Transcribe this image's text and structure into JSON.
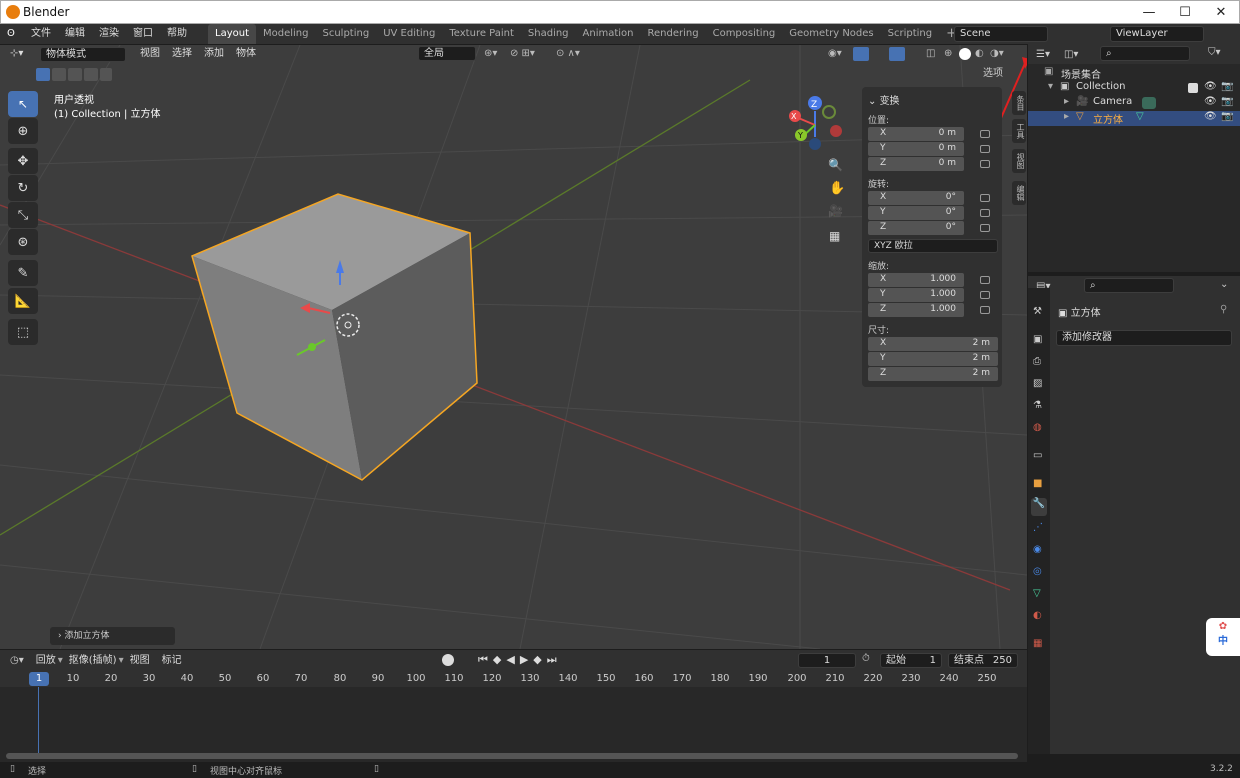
{
  "window": {
    "title": "Blender"
  },
  "menu": [
    "文件",
    "编辑",
    "渲染",
    "窗口",
    "帮助"
  ],
  "workspaces": [
    "Layout",
    "Modeling",
    "Sculpting",
    "UV Editing",
    "Texture Paint",
    "Shading",
    "Animation",
    "Rendering",
    "Compositing",
    "Geometry Nodes",
    "Scripting"
  ],
  "active_workspace": "Layout",
  "scene": "Scene",
  "view_layer": "ViewLayer",
  "viewport": {
    "mode": "物体模式",
    "menus": [
      "视图",
      "选择",
      "添加",
      "物体"
    ],
    "orientation": "全局",
    "options_label": "选项",
    "view_name": "用户透视",
    "collection_info": "(1) Collection | 立方体",
    "last_op": "添加立方体",
    "sidebar_tabs": [
      "条目",
      "工具",
      "视图",
      "编辑"
    ]
  },
  "transform_panel": {
    "title": "变换",
    "location_label": "位置:",
    "location": [
      {
        "axis": "X",
        "value": "0 m"
      },
      {
        "axis": "Y",
        "value": "0 m"
      },
      {
        "axis": "Z",
        "value": "0 m"
      }
    ],
    "rotation_label": "旋转:",
    "rotation": [
      {
        "axis": "X",
        "value": "0°"
      },
      {
        "axis": "Y",
        "value": "0°"
      },
      {
        "axis": "Z",
        "value": "0°"
      }
    ],
    "rotation_mode": "XYZ 欧拉",
    "scale_label": "缩放:",
    "scale": [
      {
        "axis": "X",
        "value": "1.000"
      },
      {
        "axis": "Y",
        "value": "1.000"
      },
      {
        "axis": "Z",
        "value": "1.000"
      }
    ],
    "dimensions_label": "尺寸:",
    "dimensions": [
      {
        "axis": "X",
        "value": "2 m"
      },
      {
        "axis": "Y",
        "value": "2 m"
      },
      {
        "axis": "Z",
        "value": "2 m"
      }
    ]
  },
  "outliner": {
    "root": "场景集合",
    "collection": "Collection",
    "items": [
      "Camera",
      "立方体"
    ]
  },
  "properties": {
    "object_name": "立方体",
    "add_modifier": "添加修改器"
  },
  "timeline": {
    "menus": [
      "回放",
      "抠像(插帧)",
      "视图",
      "标记"
    ],
    "current_frame": "1",
    "start_label": "起始",
    "start": "1",
    "end_label": "结束点",
    "end": "250",
    "ruler": [
      "10",
      "20",
      "30",
      "40",
      "50",
      "60",
      "70",
      "80",
      "90",
      "100",
      "110",
      "120",
      "130",
      "140",
      "150",
      "160",
      "170",
      "180",
      "190",
      "200",
      "210",
      "220",
      "230",
      "240",
      "250"
    ]
  },
  "statusbar": {
    "left": "选择",
    "middle": "视图中心对齐鼠标",
    "version": "3.2.2"
  },
  "ime": {
    "label": "中"
  },
  "colors": {
    "accent": "#4772b3",
    "selected_outline": "#f5a623",
    "annotation_arrow": "#e02020"
  }
}
